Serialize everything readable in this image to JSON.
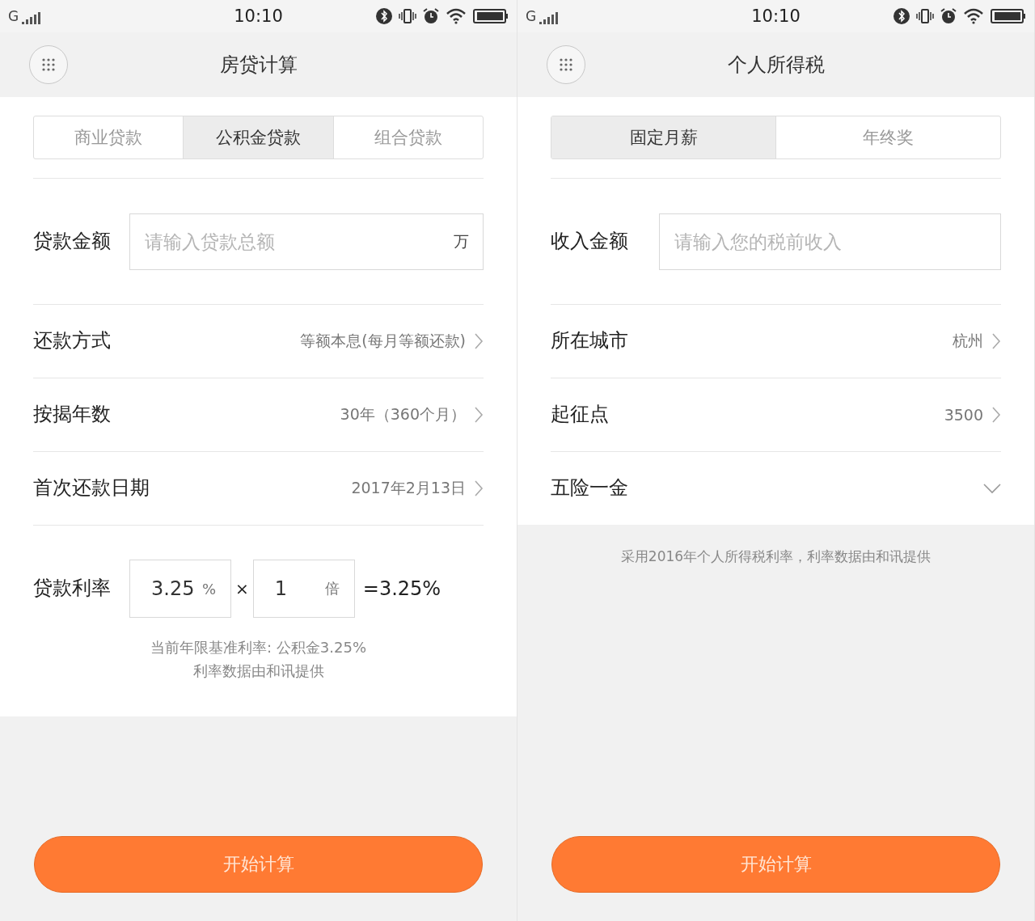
{
  "screens": [
    {
      "status_bar": {
        "network": "G",
        "time": "10:10"
      },
      "header": {
        "title": "房贷计算"
      },
      "content": [
        {
          "kind": "tabs",
          "items": [
            {
              "label": "商业贷款",
              "selected": false
            },
            {
              "label": "公积金贷款",
              "selected": true
            },
            {
              "label": "组合贷款",
              "selected": false
            }
          ]
        },
        {
          "kind": "field",
          "label": "贷款金额",
          "placeholder": "请输入贷款总额",
          "unit": "万"
        },
        {
          "kind": "link",
          "label": "还款方式",
          "value": "等额本息(每月等额还款)"
        },
        {
          "kind": "link",
          "label": "按揭年数",
          "value": "30年（360个月）"
        },
        {
          "kind": "link",
          "label": "首次还款日期",
          "value": "2017年2月13日"
        },
        {
          "kind": "rate",
          "label": "贷款利率",
          "base": "3.25",
          "base_unit": "%",
          "operator": "×",
          "multiplier": "1",
          "multiplier_unit": "倍",
          "result": "=3.25%",
          "notes": [
            "当前年限基准利率: 公积金3.25%",
            "利率数据由和讯提供"
          ]
        }
      ],
      "button": "开始计算"
    },
    {
      "status_bar": {
        "network": "G",
        "time": "10:10"
      },
      "header": {
        "title": "个人所得税"
      },
      "content": [
        {
          "kind": "tabs",
          "items": [
            {
              "label": "固定月薪",
              "selected": true
            },
            {
              "label": "年终奖",
              "selected": false
            }
          ]
        },
        {
          "kind": "field",
          "label": "收入金额",
          "placeholder": "请输入您的税前收入"
        },
        {
          "kind": "link",
          "label": "所在城市",
          "value": "杭州"
        },
        {
          "kind": "link",
          "label": "起征点",
          "value": "3500"
        },
        {
          "kind": "dropdown",
          "label": "五险一金"
        }
      ],
      "footnote": "采用2016年个人所得税利率，利率数据由和讯提供",
      "button": "开始计算"
    }
  ]
}
